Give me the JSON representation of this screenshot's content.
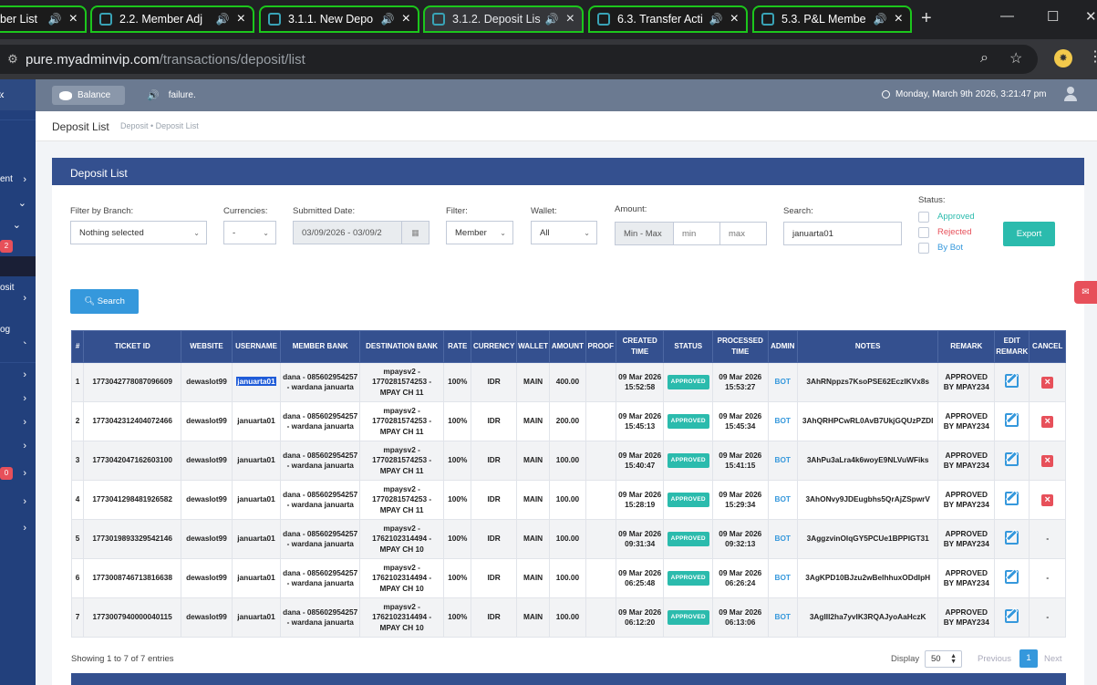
{
  "browser": {
    "tabs": [
      {
        "label": "ber List",
        "active": false
      },
      {
        "label": "2.2. Member Adj",
        "active": false
      },
      {
        "label": "3.1.1. New Depo",
        "active": false
      },
      {
        "label": "3.1.2. Deposit Lis",
        "active": true
      },
      {
        "label": "6.3. Transfer Acti",
        "active": false
      },
      {
        "label": "5.3. P&L Membe",
        "active": false
      }
    ],
    "url_host": "pure.myadminvip.com",
    "url_path": "/transactions/deposit/list"
  },
  "sidebar": {
    "items": [
      {
        "label": "ent"
      },
      {
        "label": "osit"
      },
      {
        "label": "og"
      }
    ],
    "badges": [
      "2",
      "0"
    ]
  },
  "header": {
    "balance_label": "Balance",
    "announcement": "failure.",
    "datetime": "Monday, March 9th 2026, 3:21:47 pm"
  },
  "breadcrumb": {
    "title": "Deposit List",
    "path": "Deposit • Deposit List"
  },
  "portlet": {
    "title": "Deposit List"
  },
  "filters": {
    "branch_label": "Filter by Branch:",
    "branch_value": "Nothing selected",
    "currencies_label": "Currencies:",
    "currencies_value": "-",
    "date_label": "Submitted Date:",
    "date_value": "03/09/2026 - 03/09/2",
    "filter_label": "Filter:",
    "filter_value": "Member",
    "wallet_label": "Wallet:",
    "wallet_value": "All",
    "amount_label": "Amount:",
    "amount_addon": "Min - Max",
    "amount_min_placeholder": "min",
    "amount_max_placeholder": "max",
    "search_label": "Search:",
    "search_value": "januarta01",
    "status_label": "Status:",
    "status_options": [
      {
        "label": "Approved",
        "color": "#2bbbad"
      },
      {
        "label": "Rejected",
        "color": "#e7505a"
      },
      {
        "label": "By Bot",
        "color": "#3598dc"
      }
    ],
    "export_label": "Export",
    "search_button_label": "Search"
  },
  "table": {
    "columns": [
      "#",
      "TICKET ID",
      "WEBSITE",
      "USERNAME",
      "MEMBER BANK",
      "DESTINATION BANK",
      "RATE",
      "CURRENCY",
      "WALLET",
      "AMOUNT",
      "PROOF",
      "CREATED TIME",
      "STATUS",
      "PROCESSED TIME",
      "ADMIN",
      "NOTES",
      "REMARK",
      "EDIT REMARK",
      "CANCEL"
    ],
    "rows": [
      {
        "no": "1",
        "ticket": "1773042778087096609",
        "website": "dewaslot99",
        "username": "januarta01",
        "member_bank": "dana - 085602954257 - wardana januarta",
        "dest_bank": "mpaysv2 - 1770281574253 - MPAY CH 11",
        "rate": "100%",
        "currency": "IDR",
        "wallet": "MAIN",
        "amount": "400.00",
        "proof": "",
        "created": "09 Mar 2026 15:52:58",
        "status": "APPROVED",
        "processed": "09 Mar 2026 15:53:27",
        "admin": "BOT",
        "notes": "3AhRNppzs7KsoPSE62EczIKVx8s",
        "remark": "APPROVED BY MPAY234",
        "cancel": "x"
      },
      {
        "no": "2",
        "ticket": "1773042312404072466",
        "website": "dewaslot99",
        "username": "januarta01",
        "member_bank": "dana - 085602954257 - wardana januarta",
        "dest_bank": "mpaysv2 - 1770281574253 - MPAY CH 11",
        "rate": "100%",
        "currency": "IDR",
        "wallet": "MAIN",
        "amount": "200.00",
        "proof": "",
        "created": "09 Mar 2026 15:45:13",
        "status": "APPROVED",
        "processed": "09 Mar 2026 15:45:34",
        "admin": "BOT",
        "notes": "3AhQRHPCwRL0AvB7UkjGQUzPZDI",
        "remark": "APPROVED BY MPAY234",
        "cancel": "x"
      },
      {
        "no": "3",
        "ticket": "1773042047162603100",
        "website": "dewaslot99",
        "username": "januarta01",
        "member_bank": "dana - 085602954257 - wardana januarta",
        "dest_bank": "mpaysv2 - 1770281574253 - MPAY CH 11",
        "rate": "100%",
        "currency": "IDR",
        "wallet": "MAIN",
        "amount": "100.00",
        "proof": "",
        "created": "09 Mar 2026 15:40:47",
        "status": "APPROVED",
        "processed": "09 Mar 2026 15:41:15",
        "admin": "BOT",
        "notes": "3AhPu3aLra4k6woyE9NLVuWFiks",
        "remark": "APPROVED BY MPAY234",
        "cancel": "x"
      },
      {
        "no": "4",
        "ticket": "1773041298481926582",
        "website": "dewaslot99",
        "username": "januarta01",
        "member_bank": "dana - 085602954257 - wardana januarta",
        "dest_bank": "mpaysv2 - 1770281574253 - MPAY CH 11",
        "rate": "100%",
        "currency": "IDR",
        "wallet": "MAIN",
        "amount": "100.00",
        "proof": "",
        "created": "09 Mar 2026 15:28:19",
        "status": "APPROVED",
        "processed": "09 Mar 2026 15:29:34",
        "admin": "BOT",
        "notes": "3AhONvy9JDEugbhs5QrAjZSpwrV",
        "remark": "APPROVED BY MPAY234",
        "cancel": "x"
      },
      {
        "no": "5",
        "ticket": "1773019893329542146",
        "website": "dewaslot99",
        "username": "januarta01",
        "member_bank": "dana - 085602954257 - wardana januarta",
        "dest_bank": "mpaysv2 - 1762102314494 - MPAY CH 10",
        "rate": "100%",
        "currency": "IDR",
        "wallet": "MAIN",
        "amount": "100.00",
        "proof": "",
        "created": "09 Mar 2026 09:31:34",
        "status": "APPROVED",
        "processed": "09 Mar 2026 09:32:13",
        "admin": "BOT",
        "notes": "3AggzvinOlqGY5PCUe1BPPIGT31",
        "remark": "APPROVED BY MPAY234",
        "cancel": "-"
      },
      {
        "no": "6",
        "ticket": "1773008746713816638",
        "website": "dewaslot99",
        "username": "januarta01",
        "member_bank": "dana - 085602954257 - wardana januarta",
        "dest_bank": "mpaysv2 - 1762102314494 - MPAY CH 10",
        "rate": "100%",
        "currency": "IDR",
        "wallet": "MAIN",
        "amount": "100.00",
        "proof": "",
        "created": "09 Mar 2026 06:25:48",
        "status": "APPROVED",
        "processed": "09 Mar 2026 06:26:24",
        "admin": "BOT",
        "notes": "3AgKPD10BJzu2wBeIhhuxODdIpH",
        "remark": "APPROVED BY MPAY234",
        "cancel": "-"
      },
      {
        "no": "7",
        "ticket": "1773007940000040115",
        "website": "dewaslot99",
        "username": "januarta01",
        "member_bank": "dana - 085602954257 - wardana januarta",
        "dest_bank": "mpaysv2 - 1762102314494 - MPAY CH 10",
        "rate": "100%",
        "currency": "IDR",
        "wallet": "MAIN",
        "amount": "100.00",
        "proof": "",
        "created": "09 Mar 2026 06:12:20",
        "status": "APPROVED",
        "processed": "09 Mar 2026 06:13:06",
        "admin": "BOT",
        "notes": "3AgIIl2ha7yvIK3RQAJyoAaHczK",
        "remark": "APPROVED BY MPAY234",
        "cancel": "-"
      }
    ]
  },
  "footer": {
    "showing": "Showing 1 to 7 of 7 entries",
    "display_label": "Display",
    "display_value": "50",
    "prev_label": "Previous",
    "current_page": "1",
    "next_label": "Next"
  }
}
